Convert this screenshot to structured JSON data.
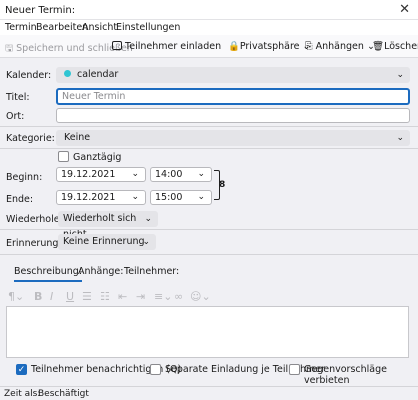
{
  "window": {
    "title": "Neuer Termin:"
  },
  "menu": [
    "Termin",
    "Bearbeiten",
    "Ansicht",
    "Einstellungen"
  ],
  "toolbar": {
    "save": "Speichern und schließen",
    "invite": "Teilnehmer einladen",
    "privacy": "Privatsphäre",
    "attach": "Anhängen",
    "delete": "Löschen"
  },
  "form": {
    "calendar_label": "Kalender:",
    "calendar_value": "calendar",
    "calendar_color": "#2fc5d3",
    "title_label": "Titel:",
    "title_placeholder": "Neuer Termin",
    "location_label": "Ort:",
    "category_label": "Kategorie:",
    "category_value": "Keine",
    "allday_label": "Ganztägig",
    "start_label": "Beginn:",
    "start_date": "19.12.2021",
    "start_time": "14:00",
    "end_label": "Ende:",
    "end_date": "19.12.2021",
    "end_time": "15:00",
    "repeat_label": "Wiederholen:",
    "repeat_value": "Wiederholt sich nicht",
    "reminder_label": "Erinnerung:",
    "reminder_value": "Keine Erinnerung"
  },
  "tabs": [
    "Beschreibung:",
    "Anhänge:",
    "Teilnehmer:"
  ],
  "footer_options": [
    "Teilnehmer benachrichtigen (Q)",
    "Separate Einladung je Teilnehmer",
    "Gegenvorschläge verbieten"
  ],
  "status": {
    "label": "Zeit als:",
    "value": "Beschäftigt"
  },
  "colors": {
    "accent": "#1c6bbf"
  }
}
